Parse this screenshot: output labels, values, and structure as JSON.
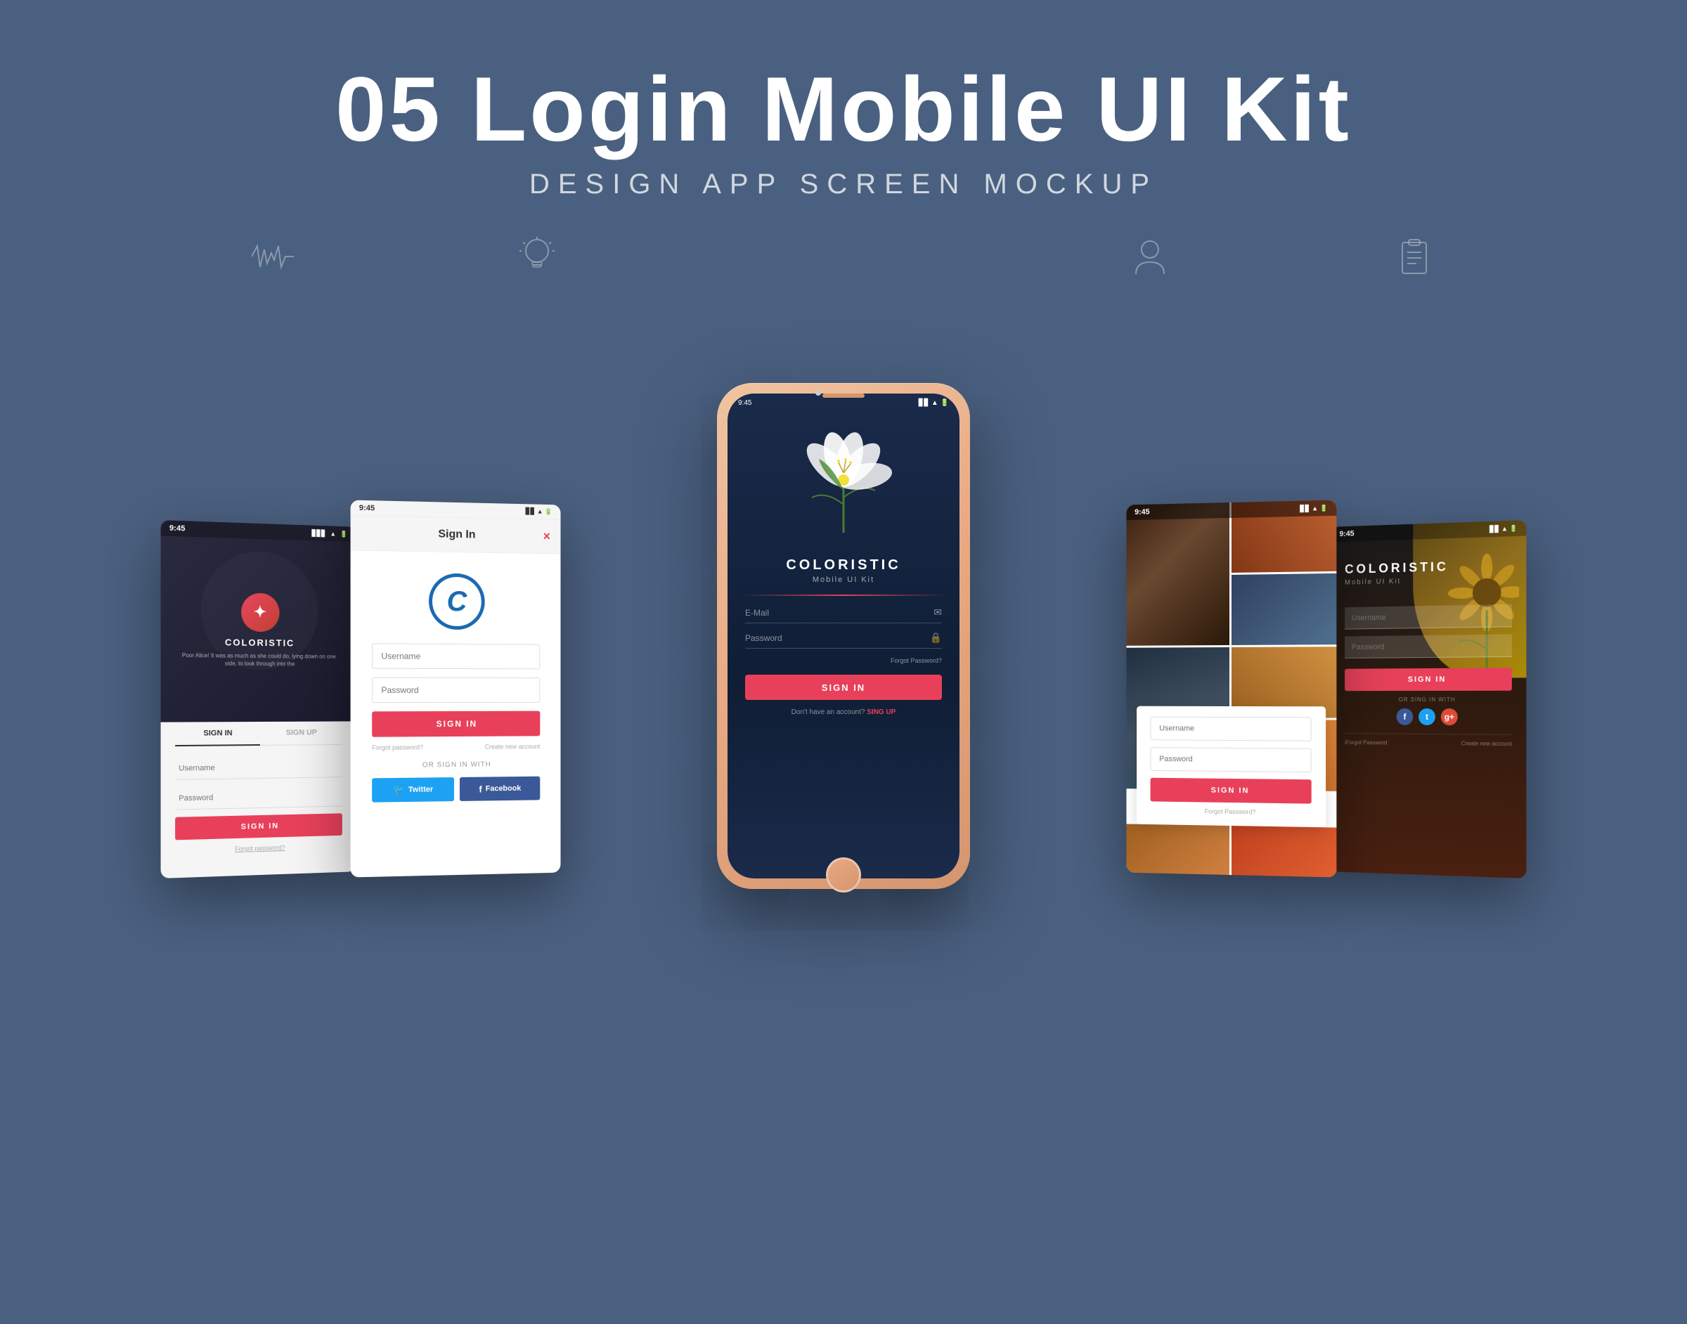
{
  "page": {
    "title": "05 Login Mobile UI Kit",
    "subtitle": "DESIGN APP SCREEN MOCKUP",
    "background_color": "#4a6080"
  },
  "screen1": {
    "time": "9:45",
    "brand": "COLORISTIC",
    "tagline": "Poor Alice! It was as much as she could do, lying down on one side, to look through into the",
    "tab_signin": "SIGN IN",
    "tab_signup": "SIGN UP",
    "username_placeholder": "Username",
    "password_placeholder": "Password",
    "signin_button": "SIGN IN",
    "forgot_password": "Forgot password?"
  },
  "screen2": {
    "time": "9:45",
    "header": "Sign In",
    "close": "×",
    "logo_letter": "C",
    "username_placeholder": "Username",
    "password_placeholder": "Password",
    "signin_button": "SIGN IN",
    "forgot_password": "Forgot password?",
    "create_account": "Create new account",
    "or_signin_with": "OR SIGN IN WITH",
    "twitter_button": "Twitter",
    "facebook_button": "Facebook"
  },
  "screen_center": {
    "time": "9:45",
    "brand": "COLORISTIC",
    "subtitle": "Mobile UI Kit",
    "email_placeholder": "E-Mail",
    "password_placeholder": "Password",
    "forgot_password": "Forgot Password?",
    "signin_button": "SIGN IN",
    "no_account": "Don't have an account?",
    "signup_link": "SING UP"
  },
  "screen4": {
    "time": "9:45",
    "username_placeholder": "Username",
    "password_placeholder": "Password",
    "signin_button": "SIGN IN",
    "forgot_password": "Forgot Password?"
  },
  "screen5": {
    "time": "9:45",
    "brand": "COLORISTIC",
    "subtitle": "Mobile UI Kit",
    "username_placeholder": "Username",
    "password_placeholder": "Password",
    "signin_button": "SIGN IN",
    "or_signin_with": "OR SING IN WITH",
    "forgot_password": "iForgot Password",
    "create_account": "Create new account",
    "social": {
      "facebook": "f",
      "twitter": "t",
      "google": "g+"
    }
  }
}
